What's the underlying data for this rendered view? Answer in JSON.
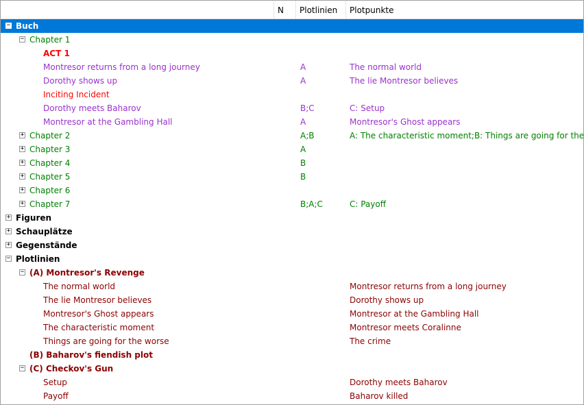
{
  "header": {
    "columns": [
      "",
      "N",
      "Plotlinien",
      "Plotpunkte"
    ]
  },
  "colors": {
    "selection": "#0078d7",
    "chapter": "#008000",
    "scene": "#9932cc",
    "act": "#ff0000",
    "incident": "#ff0000",
    "plotline": "#8b0000",
    "category": "#000000"
  },
  "rows": [
    {
      "label": "Buch",
      "level": 0,
      "expander": "-",
      "kind": "category",
      "bold": true,
      "selected": true,
      "plotlinien": "",
      "plotpunkte": ""
    },
    {
      "label": "Chapter 1",
      "level": 1,
      "expander": "-",
      "kind": "chapter",
      "plotlinien": "",
      "plotpunkte": ""
    },
    {
      "label": "ACT 1",
      "level": 2,
      "expander": "",
      "kind": "act",
      "bold": true,
      "plotlinien": "",
      "plotpunkte": ""
    },
    {
      "label": "Montresor returns from a long journey",
      "level": 2,
      "expander": "",
      "kind": "scene",
      "plotlinien": "A",
      "plotpunkte": "The normal world"
    },
    {
      "label": "Dorothy shows up",
      "level": 2,
      "expander": "",
      "kind": "scene",
      "plotlinien": "A",
      "plotpunkte": "The lie Montresor believes"
    },
    {
      "label": "Inciting Incident",
      "level": 2,
      "expander": "",
      "kind": "incident",
      "plotlinien": "",
      "plotpunkte": ""
    },
    {
      "label": "Dorothy meets Baharov",
      "level": 2,
      "expander": "",
      "kind": "scene",
      "plotlinien": "B;C",
      "plotpunkte": "C: Setup"
    },
    {
      "label": "Montresor at the Gambling Hall",
      "level": 2,
      "expander": "",
      "kind": "scene",
      "plotlinien": "A",
      "plotpunkte": "Montresor's Ghost appears"
    },
    {
      "label": "Chapter 2",
      "level": 1,
      "expander": "+",
      "kind": "chapter",
      "plotlinien": "A;B",
      "plotpunkte": "A: The characteristic moment;B: Things are going for the worse"
    },
    {
      "label": "Chapter 3",
      "level": 1,
      "expander": "+",
      "kind": "chapter",
      "plotlinien": "A",
      "plotpunkte": ""
    },
    {
      "label": "Chapter 4",
      "level": 1,
      "expander": "+",
      "kind": "chapter",
      "plotlinien": "B",
      "plotpunkte": ""
    },
    {
      "label": "Chapter 5",
      "level": 1,
      "expander": "+",
      "kind": "chapter",
      "plotlinien": "B",
      "plotpunkte": ""
    },
    {
      "label": "Chapter 6",
      "level": 1,
      "expander": "+",
      "kind": "chapter",
      "plotlinien": "",
      "plotpunkte": ""
    },
    {
      "label": "Chapter 7",
      "level": 1,
      "expander": "+",
      "kind": "chapter",
      "plotlinien": "B;A;C",
      "plotpunkte": "C: Payoff"
    },
    {
      "label": "Figuren",
      "level": 0,
      "expander": "+",
      "kind": "category",
      "bold": true,
      "plotlinien": "",
      "plotpunkte": ""
    },
    {
      "label": "Schauplätze",
      "level": 0,
      "expander": "+",
      "kind": "category",
      "bold": true,
      "plotlinien": "",
      "plotpunkte": ""
    },
    {
      "label": "Gegenstände",
      "level": 0,
      "expander": "+",
      "kind": "category",
      "bold": true,
      "plotlinien": "",
      "plotpunkte": ""
    },
    {
      "label": "Plotlinien",
      "level": 0,
      "expander": "-",
      "kind": "category",
      "bold": true,
      "plotlinien": "",
      "plotpunkte": ""
    },
    {
      "label": "(A) Montresor's Revenge",
      "level": 1,
      "expander": "-",
      "kind": "plotline",
      "bold": true,
      "plotlinien": "",
      "plotpunkte": ""
    },
    {
      "label": "The normal world",
      "level": 2,
      "expander": "",
      "kind": "plotline",
      "plotlinien": "",
      "plotpunkte": "Montresor returns from a long journey"
    },
    {
      "label": "The lie Montresor believes",
      "level": 2,
      "expander": "",
      "kind": "plotline",
      "plotlinien": "",
      "plotpunkte": "Dorothy shows up"
    },
    {
      "label": "Montresor's Ghost appears",
      "level": 2,
      "expander": "",
      "kind": "plotline",
      "plotlinien": "",
      "plotpunkte": "Montresor at the Gambling Hall"
    },
    {
      "label": "The characteristic moment",
      "level": 2,
      "expander": "",
      "kind": "plotline",
      "plotlinien": "",
      "plotpunkte": "Montresor meets Coralinne"
    },
    {
      "label": "Things are going for the worse",
      "level": 2,
      "expander": "",
      "kind": "plotline",
      "plotlinien": "",
      "plotpunkte": "The crime"
    },
    {
      "label": "(B) Baharov's fiendish plot",
      "level": 1,
      "expander": "",
      "kind": "plotline",
      "bold": true,
      "plotlinien": "",
      "plotpunkte": ""
    },
    {
      "label": "(C) Checkov's Gun",
      "level": 1,
      "expander": "-",
      "kind": "plotline",
      "bold": true,
      "plotlinien": "",
      "plotpunkte": ""
    },
    {
      "label": "Setup",
      "level": 2,
      "expander": "",
      "kind": "plotline",
      "plotlinien": "",
      "plotpunkte": "Dorothy meets Baharov"
    },
    {
      "label": "Payoff",
      "level": 2,
      "expander": "",
      "kind": "plotline",
      "plotlinien": "",
      "plotpunkte": "Baharov killed"
    }
  ]
}
